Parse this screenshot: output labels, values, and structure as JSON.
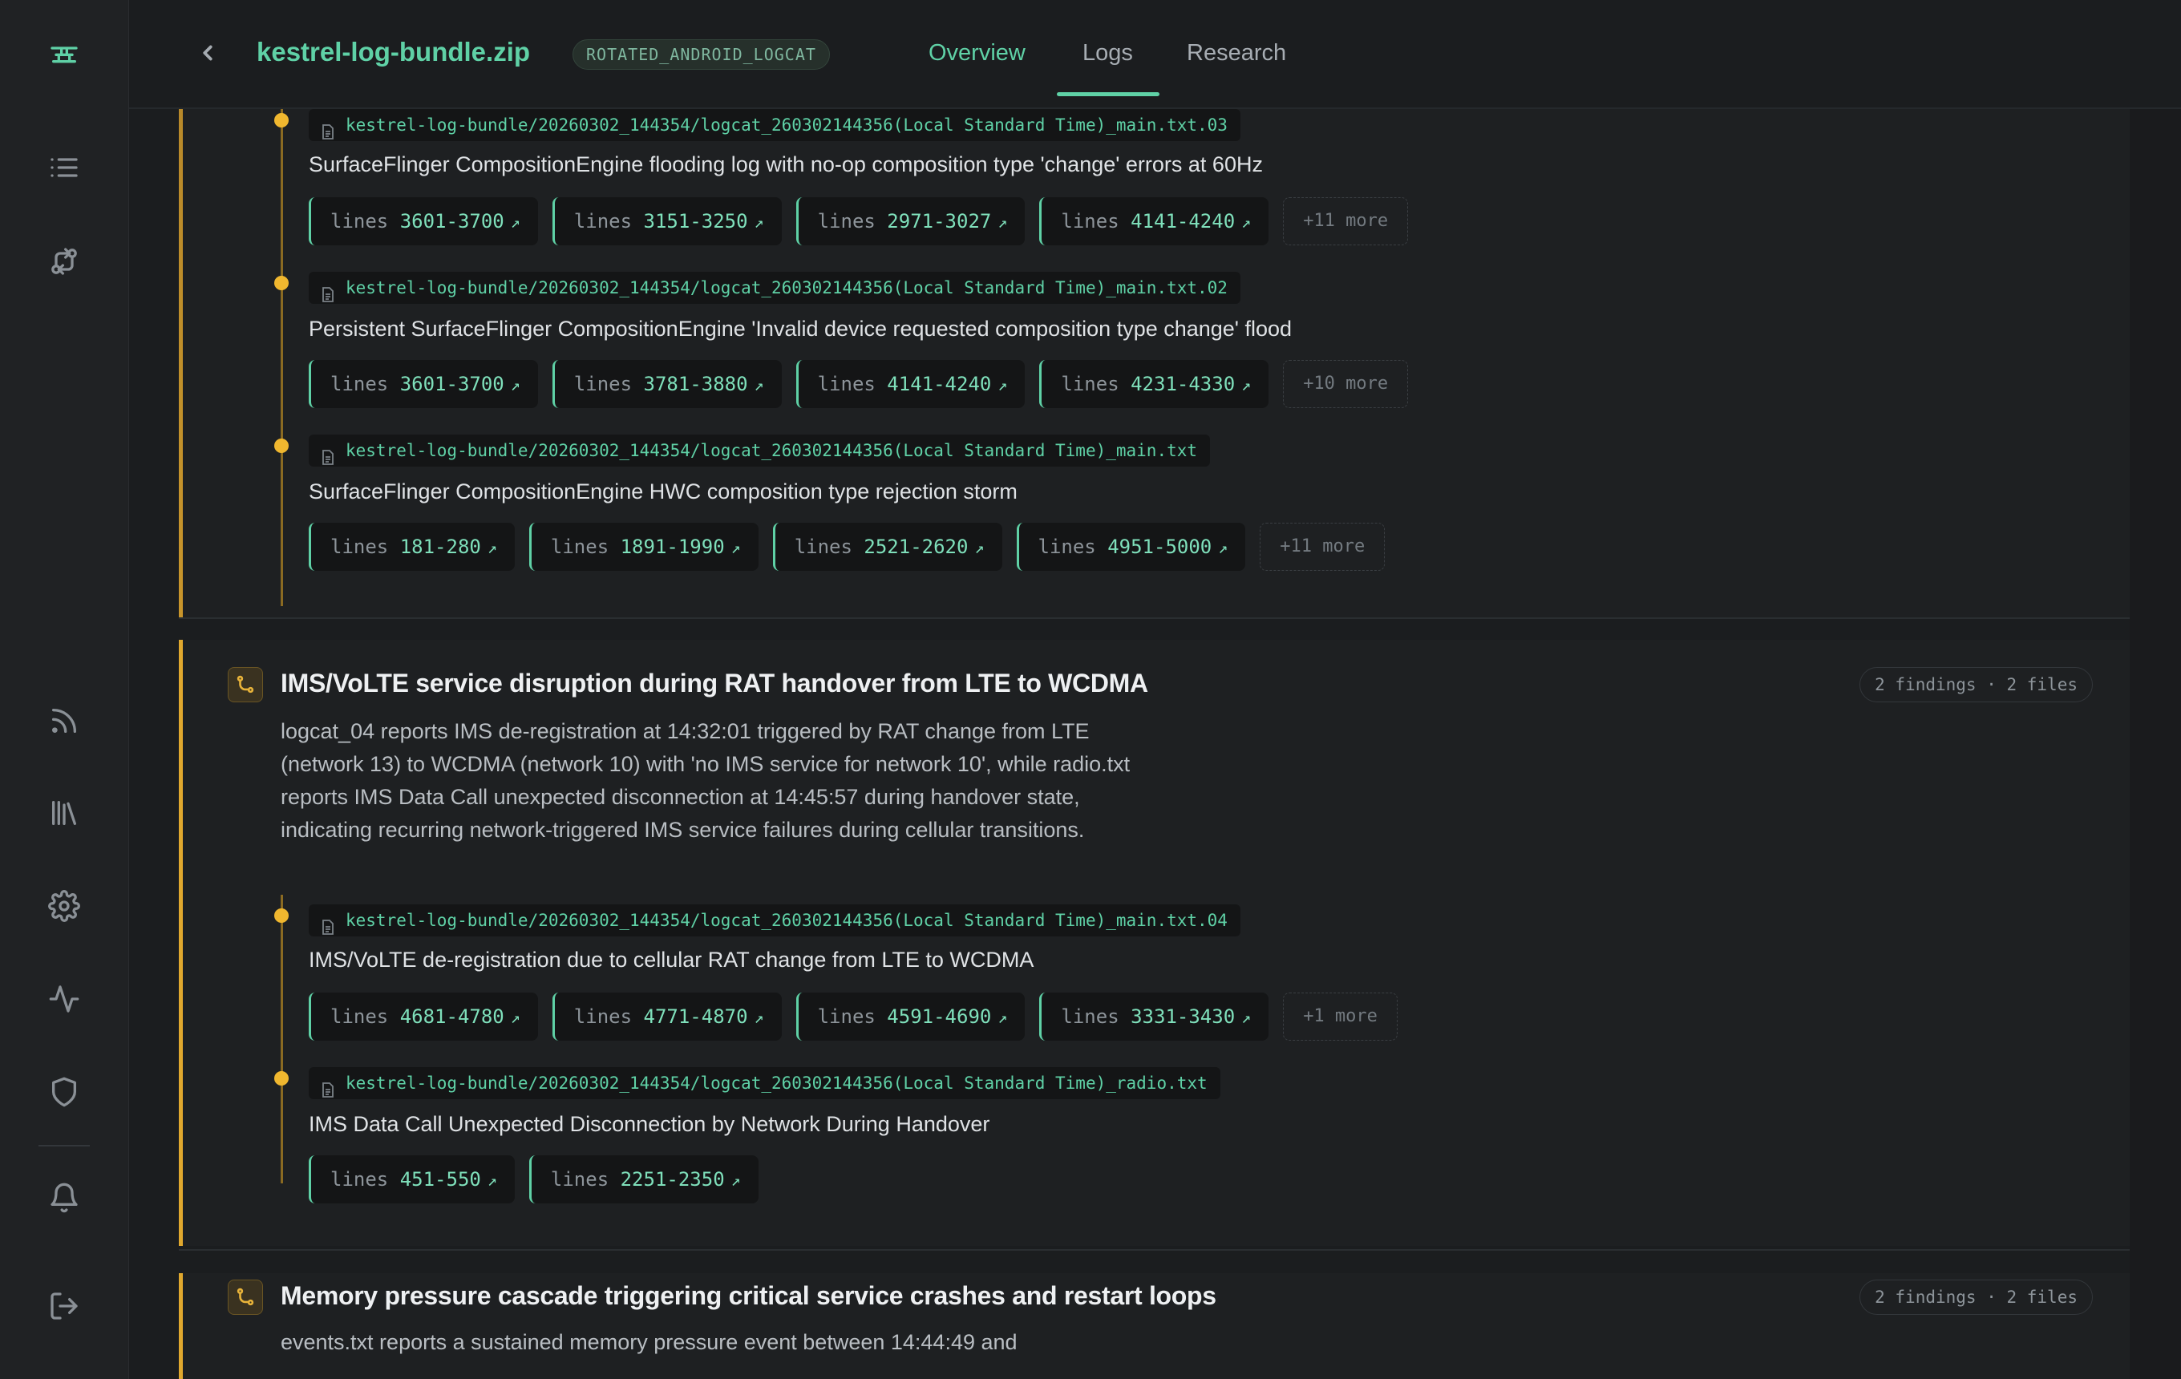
{
  "header": {
    "file_title": "kestrel-log-bundle.zip",
    "type_badge": "ROTATED_ANDROID_LOGCAT",
    "tabs": [
      {
        "label": "Overview",
        "active": true
      },
      {
        "label": "Logs",
        "active": false
      },
      {
        "label": "Research",
        "active": false
      }
    ]
  },
  "sidebar": {
    "items": [
      {
        "icon": "brand-logo-icon"
      },
      {
        "icon": "list-icon"
      },
      {
        "icon": "compare-icon"
      },
      {
        "icon": "rss-icon"
      },
      {
        "icon": "library-icon"
      },
      {
        "icon": "gear-icon"
      },
      {
        "icon": "activity-icon"
      },
      {
        "icon": "shield-icon"
      },
      {
        "icon": "bell-icon"
      },
      {
        "icon": "logout-icon"
      }
    ]
  },
  "colors": {
    "accent": "#5fd1a6",
    "warning": "#f0b72f",
    "background": "#1b1d1f"
  },
  "groups": [
    {
      "findings": [
        {
          "path": "kestrel-log-bundle/20260302_144354/logcat_260302144356(Local Standard Time)_main.txt.03",
          "summary": "SurfaceFlinger CompositionEngine flooding log with no-op composition type 'change' errors at 60Hz",
          "chip_label": "lines",
          "ranges": [
            "3601-3700",
            "3151-3250",
            "2971-3027",
            "4141-4240"
          ],
          "more": "+11 more"
        },
        {
          "path": "kestrel-log-bundle/20260302_144354/logcat_260302144356(Local Standard Time)_main.txt.02",
          "summary": "Persistent SurfaceFlinger CompositionEngine 'Invalid device requested composition type change' flood",
          "chip_label": "lines",
          "ranges": [
            "3601-3700",
            "3781-3880",
            "4141-4240",
            "4231-4330"
          ],
          "more": "+10 more"
        },
        {
          "path": "kestrel-log-bundle/20260302_144354/logcat_260302144356(Local Standard Time)_main.txt",
          "summary": "SurfaceFlinger CompositionEngine HWC composition type rejection storm",
          "chip_label": "lines",
          "ranges": [
            "181-280",
            "1891-1990",
            "2521-2620",
            "4951-5000"
          ],
          "more": "+11 more"
        }
      ]
    },
    {
      "title": "IMS/VoLTE service disruption during RAT handover from LTE to WCDMA",
      "meta": "2 findings · 2 files",
      "description": "logcat_04 reports IMS de-registration at 14:32:01 triggered by RAT change from LTE (network 13) to WCDMA (network 10) with 'no IMS service for network 10', while radio.txt reports IMS Data Call unexpected disconnection at 14:45:57 during handover state, indicating recurring network-triggered IMS service failures during cellular transitions.",
      "findings": [
        {
          "path": "kestrel-log-bundle/20260302_144354/logcat_260302144356(Local Standard Time)_main.txt.04",
          "summary": "IMS/VoLTE de-registration due to cellular RAT change from LTE to WCDMA",
          "chip_label": "lines",
          "ranges": [
            "4681-4780",
            "4771-4870",
            "4591-4690",
            "3331-3430"
          ],
          "more": "+1 more"
        },
        {
          "path": "kestrel-log-bundle/20260302_144354/logcat_260302144356(Local Standard Time)_radio.txt",
          "summary": "IMS Data Call Unexpected Disconnection by Network During Handover",
          "chip_label": "lines",
          "ranges": [
            "451-550",
            "2251-2350"
          ],
          "more": ""
        }
      ]
    },
    {
      "title": "Memory pressure cascade triggering critical service crashes and restart loops",
      "meta": "2 findings · 2 files",
      "description": "events.txt reports a sustained memory pressure event between 14:44:49 and"
    }
  ]
}
